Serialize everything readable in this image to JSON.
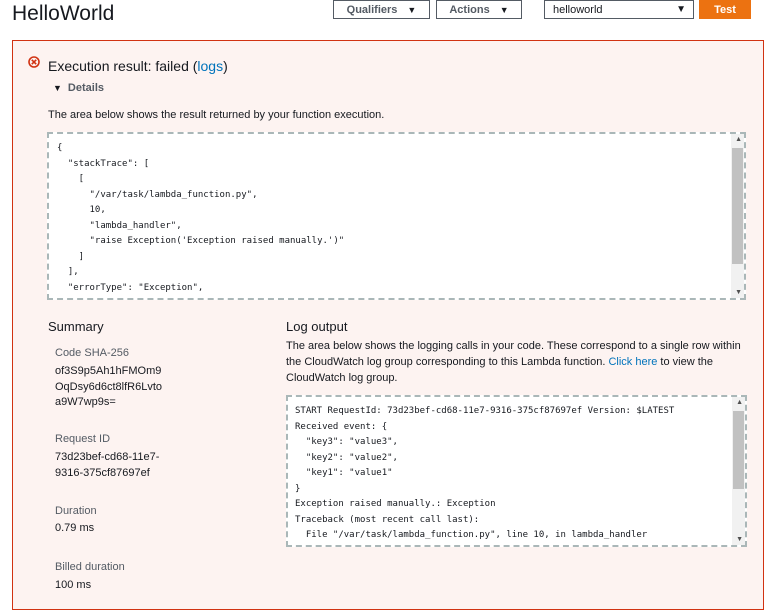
{
  "header": {
    "title": "HelloWorld",
    "qualifiers_label": "Qualifiers",
    "actions_label": "Actions",
    "test_event_value": "helloworld",
    "test_label": "Test"
  },
  "result": {
    "status_prefix": "Execution result: failed (",
    "logs_link": "logs",
    "status_suffix": ")",
    "details_label": "Details",
    "description": "The area below shows the result returned by your function execution.",
    "output": "{\n  \"stackTrace\": [\n    [\n      \"/var/task/lambda_function.py\",\n      10,\n      \"lambda_handler\",\n      \"raise Exception('Exception raised manually.')\"\n    ]\n  ],\n  \"errorType\": \"Exception\",\n  \"errorMessage\": \"Exception raised manually.\""
  },
  "summary": {
    "heading": "Summary",
    "code_sha_label": "Code SHA-256",
    "code_sha_value": "of3S9p5Ah1hFMOm9\nOqDsy6d6ct8lfR6Lvto\na9W7wp9s=",
    "request_id_label": "Request ID",
    "request_id_value": "73d23bef-cd68-11e7-\n9316-375cf87697ef",
    "duration_label": "Duration",
    "duration_value": "0.79 ms",
    "billed_label": "Billed duration",
    "billed_value": "100 ms"
  },
  "log": {
    "heading": "Log output",
    "desc_before": "The area below shows the logging calls in your code. These correspond to a single row within the CloudWatch log group corresponding to this Lambda function. ",
    "click_here": "Click here",
    "desc_after": " to view the CloudWatch log group.",
    "output": "START RequestId: 73d23bef-cd68-11e7-9316-375cf87697ef Version: $LATEST\nReceived event: {\n  \"key3\": \"value3\",\n  \"key2\": \"value2\",\n  \"key1\": \"value1\"\n}\nException raised manually.: Exception\nTraceback (most recent call last):\n  File \"/var/task/lambda_function.py\", line 10, in lambda_handler\n    raise Exception('Exception raised manually.')"
  },
  "colors": {
    "accent": "#ec7211",
    "error_border": "#d13212",
    "error_bg": "#fdf3f1",
    "link": "#0073bb"
  }
}
